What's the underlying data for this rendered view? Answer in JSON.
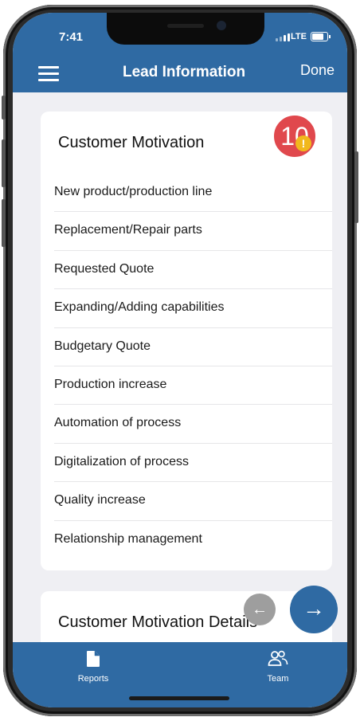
{
  "status_bar": {
    "time": "7:41",
    "network": "LTE"
  },
  "nav": {
    "title": "Lead Information",
    "done_label": "Done"
  },
  "motivation_card": {
    "title": "Customer Motivation",
    "badge_count": "10",
    "warning_symbol": "!",
    "options": [
      "New product/production line",
      "Replacement/Repair parts",
      "Requested Quote",
      "Expanding/Adding capabilities",
      "Budgetary Quote",
      "Production increase",
      "Automation of process",
      "Digitalization of process",
      "Quality increase",
      "Relationship management"
    ]
  },
  "details_card": {
    "title": "Customer Motivation Details"
  },
  "fab": {
    "back_icon": "arrow-left-icon",
    "next_icon": "arrow-right-icon"
  },
  "tab_bar": {
    "reports_label": "Reports",
    "reports_icon": "document-icon",
    "team_label": "Team",
    "team_icon": "people-icon"
  },
  "colors": {
    "brand_blue": "#2f6aa3",
    "badge_red": "#e0484d",
    "warning_yellow": "#f1b81c",
    "background": "#efeff3"
  }
}
